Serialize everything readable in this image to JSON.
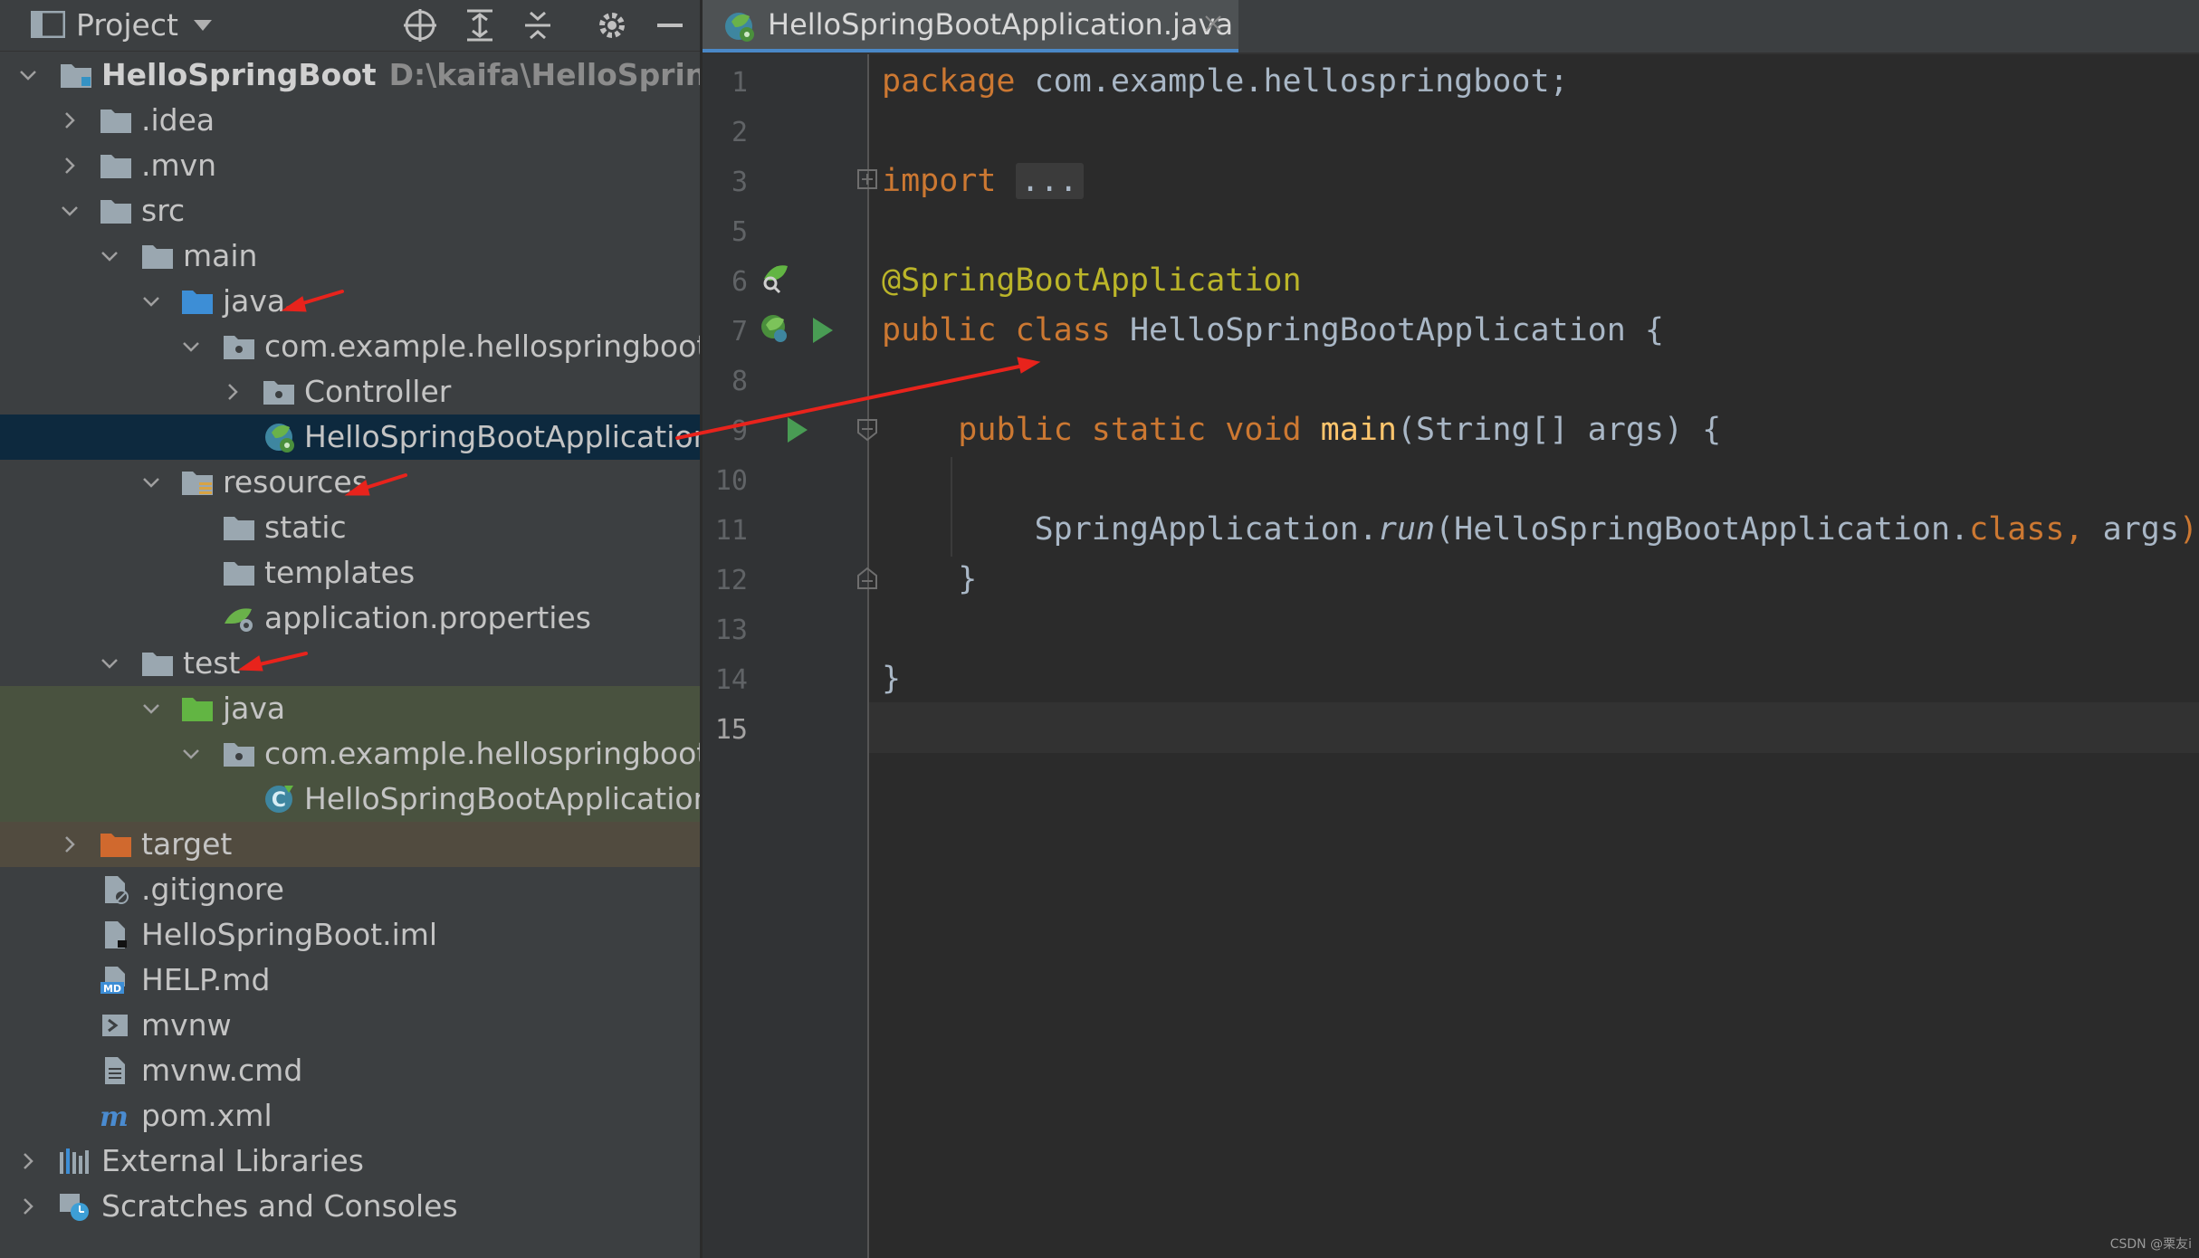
{
  "project_panel": {
    "title": "Project",
    "tree": [
      {
        "label": "HelloSpringBoot",
        "path": "D:\\kaifa\\HelloSpringBoot"
      },
      {
        "label": ".idea"
      },
      {
        "label": ".mvn"
      },
      {
        "label": "src"
      },
      {
        "label": "main"
      },
      {
        "label": "java"
      },
      {
        "label": "com.example.hellospringboot"
      },
      {
        "label": "Controller"
      },
      {
        "label": "HelloSpringBootApplication"
      },
      {
        "label": "resources"
      },
      {
        "label": "static"
      },
      {
        "label": "templates"
      },
      {
        "label": "application.properties"
      },
      {
        "label": "test"
      },
      {
        "label": "java"
      },
      {
        "label": "com.example.hellospringboot"
      },
      {
        "label": "HelloSpringBootApplicationTes"
      },
      {
        "label": "target"
      },
      {
        "label": ".gitignore"
      },
      {
        "label": "HelloSpringBoot.iml"
      },
      {
        "label": "HELP.md"
      },
      {
        "label": "mvnw"
      },
      {
        "label": "mvnw.cmd"
      },
      {
        "label": "pom.xml"
      },
      {
        "label": "External Libraries"
      },
      {
        "label": "Scratches and Consoles"
      }
    ]
  },
  "editor": {
    "tab_label": "HelloSpringBootApplication.java",
    "line_numbers": [
      "1",
      "2",
      "3",
      "5",
      "6",
      "7",
      "8",
      "9",
      "10",
      "11",
      "12",
      "13",
      "14",
      "15"
    ],
    "code": {
      "l1_kw": "package",
      "l1_rest": " com.example.hellospringboot;",
      "l3_kw": "import",
      "l3_fold": "...",
      "l6_ann": "@SpringBootApplication",
      "l7_kw": "public class",
      "l7_rest": " HelloSpringBootApplication {",
      "l9_kw": "public static void",
      "l9_fn": "main",
      "l9_rest": "(String[] args) {",
      "l11_a": "SpringApplication.",
      "l11_it": "run",
      "l11_b": "(HelloSpringBootApplication.",
      "l11_kw": "class,",
      "l11_c": " args",
      "l11_semi": ");",
      "l12": "}",
      "l14": "}"
    }
  },
  "watermark": "CSDN @栗友i",
  "colors": {
    "keyword": "#cc7832",
    "annotation": "#bbb529",
    "function": "#ffc66d",
    "text": "#a9b7c6",
    "selection": "#0d293e",
    "arrow": "#e8231c"
  }
}
